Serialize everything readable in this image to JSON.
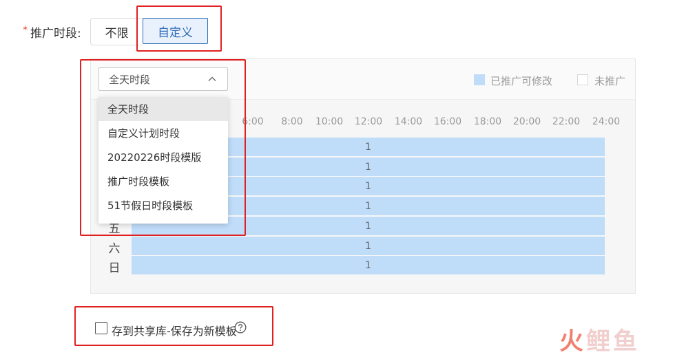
{
  "field": {
    "required_mark": "*",
    "label": "推广时段:"
  },
  "mode_buttons": {
    "unlimited": "不限",
    "custom": "自定义"
  },
  "select": {
    "value": "全天时段"
  },
  "dropdown": {
    "items": [
      "全天时段",
      "自定义计划时段",
      "20220226时段模版",
      "推广时段模板",
      "51节假日时段模板"
    ]
  },
  "legend": {
    "promoted": "已推广可修改",
    "not_promoted": "未推广"
  },
  "hours": [
    "6:00",
    "8:00",
    "10:00",
    "12:00",
    "14:00",
    "16:00",
    "18:00",
    "20:00",
    "22:00",
    "24:00"
  ],
  "rows": [
    {
      "day": "",
      "value": "1"
    },
    {
      "day": "",
      "value": "1"
    },
    {
      "day": "",
      "value": "1"
    },
    {
      "day": "",
      "value": "1"
    },
    {
      "day": "五",
      "value": "1"
    },
    {
      "day": "六",
      "value": "1"
    },
    {
      "day": "日",
      "value": "1"
    }
  ],
  "save_option": {
    "label": "存到共享库-保存为新模板"
  },
  "watermark": {
    "char1": "火",
    "rest": "鲤鱼"
  },
  "colors": {
    "promoted": "#bfdcf9",
    "accent": "#2d6bb8",
    "highlight_box": "#e02020"
  },
  "icons": {
    "chevron": "chevron-up-icon",
    "help": "help-circle-icon"
  }
}
